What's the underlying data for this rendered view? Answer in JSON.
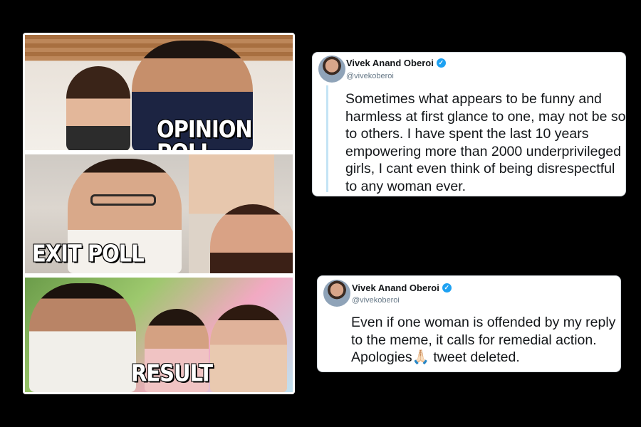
{
  "meme": {
    "panels": [
      {
        "caption": "OPINION POLL"
      },
      {
        "caption": "EXIT POLL"
      },
      {
        "caption": "RESULT"
      }
    ]
  },
  "tweets": [
    {
      "name": "Vivek Anand Oberoi",
      "handle": "@vivekoberoi",
      "verified_icon": "verified-badge",
      "text": "Sometimes what appears to be funny and harmless at first glance to one, may not be so to others. I have spent the last 10 years empowering more than 2000 underprivileged girls, I cant even think of being disrespectful to any woman ever."
    },
    {
      "name": "Vivek Anand Oberoi",
      "handle": "@vivekoberoi",
      "verified_icon": "verified-badge",
      "text": "Even if one woman is offended by my reply to the meme, it calls for remedial action. Apologies🙏🏻 tweet deleted."
    }
  ],
  "colors": {
    "background": "#000000",
    "verified": "#1da1f2",
    "thread_line": "#c4e4f5"
  }
}
